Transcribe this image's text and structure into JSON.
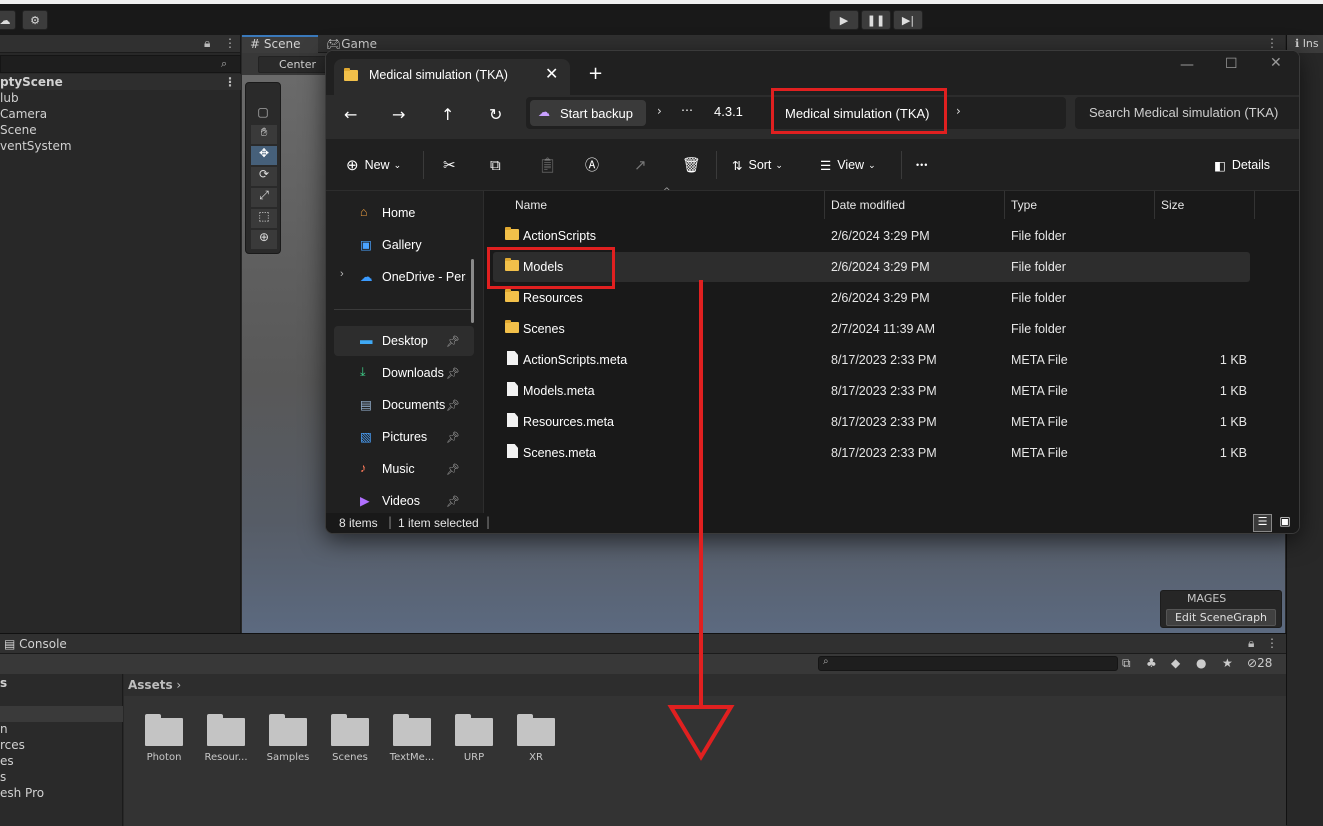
{
  "unity": {
    "hierarchy": {
      "scene_name": "ptyScene",
      "items": [
        "lub",
        "Camera",
        "Scene",
        "ventSystem"
      ]
    },
    "scene_tabs": {
      "scene": "Scene",
      "game": "Game"
    },
    "pivot_label": "Center",
    "inspector_tab": "Ins",
    "console_tab": "Console",
    "project": {
      "breadcrumb": "Assets",
      "left_items": [
        "s",
        "",
        "n",
        "rces",
        "es",
        "s",
        "esh Pro"
      ],
      "folders": [
        "Photon",
        "Resour...",
        "Samples",
        "Scenes",
        "TextMe...",
        "URP",
        "XR"
      ],
      "hidden_count": "28"
    },
    "mages": {
      "title": "MAGES",
      "button": "Edit SceneGraph"
    }
  },
  "explorer": {
    "tab_title": "Medical simulation (TKA)",
    "breadcrumb": [
      "Start backup",
      "⋯",
      "4.3.1",
      "Medical simulation (TKA)"
    ],
    "search_placeholder": "Search Medical simulation (TKA)",
    "commands": {
      "new": "New",
      "sort": "Sort",
      "view": "View",
      "more": "•••",
      "details": "Details"
    },
    "nav": [
      {
        "label": "Home",
        "icon": "home-icon",
        "pinned": false
      },
      {
        "label": "Gallery",
        "icon": "gallery-icon",
        "pinned": false
      },
      {
        "label": "OneDrive - Pers",
        "icon": "onedrive-icon",
        "pinned": false
      },
      {
        "label": "Desktop",
        "icon": "desktop-icon",
        "pinned": true
      },
      {
        "label": "Downloads",
        "icon": "download-icon",
        "pinned": true
      },
      {
        "label": "Documents",
        "icon": "documents-icon",
        "pinned": true
      },
      {
        "label": "Pictures",
        "icon": "pictures-icon",
        "pinned": true
      },
      {
        "label": "Music",
        "icon": "music-icon",
        "pinned": true
      },
      {
        "label": "Videos",
        "icon": "videos-icon",
        "pinned": true
      }
    ],
    "columns": {
      "name": "Name",
      "date": "Date modified",
      "type": "Type",
      "size": "Size"
    },
    "files": [
      {
        "name": "ActionScripts",
        "date": "2/6/2024 3:29 PM",
        "type": "File folder",
        "size": "",
        "kind": "folder"
      },
      {
        "name": "Models",
        "date": "2/6/2024 3:29 PM",
        "type": "File folder",
        "size": "",
        "kind": "folder"
      },
      {
        "name": "Resources",
        "date": "2/6/2024 3:29 PM",
        "type": "File folder",
        "size": "",
        "kind": "folder"
      },
      {
        "name": "Scenes",
        "date": "2/7/2024 11:39 AM",
        "type": "File folder",
        "size": "",
        "kind": "folder"
      },
      {
        "name": "ActionScripts.meta",
        "date": "8/17/2023 2:33 PM",
        "type": "META File",
        "size": "1 KB",
        "kind": "file"
      },
      {
        "name": "Models.meta",
        "date": "8/17/2023 2:33 PM",
        "type": "META File",
        "size": "1 KB",
        "kind": "file"
      },
      {
        "name": "Resources.meta",
        "date": "8/17/2023 2:33 PM",
        "type": "META File",
        "size": "1 KB",
        "kind": "file"
      },
      {
        "name": "Scenes.meta",
        "date": "8/17/2023 2:33 PM",
        "type": "META File",
        "size": "1 KB",
        "kind": "file"
      }
    ],
    "status": {
      "count": "8 items",
      "selected": "1 item selected"
    }
  },
  "colors": {
    "annotation": "#e02020",
    "folder": "#f2c04a"
  }
}
